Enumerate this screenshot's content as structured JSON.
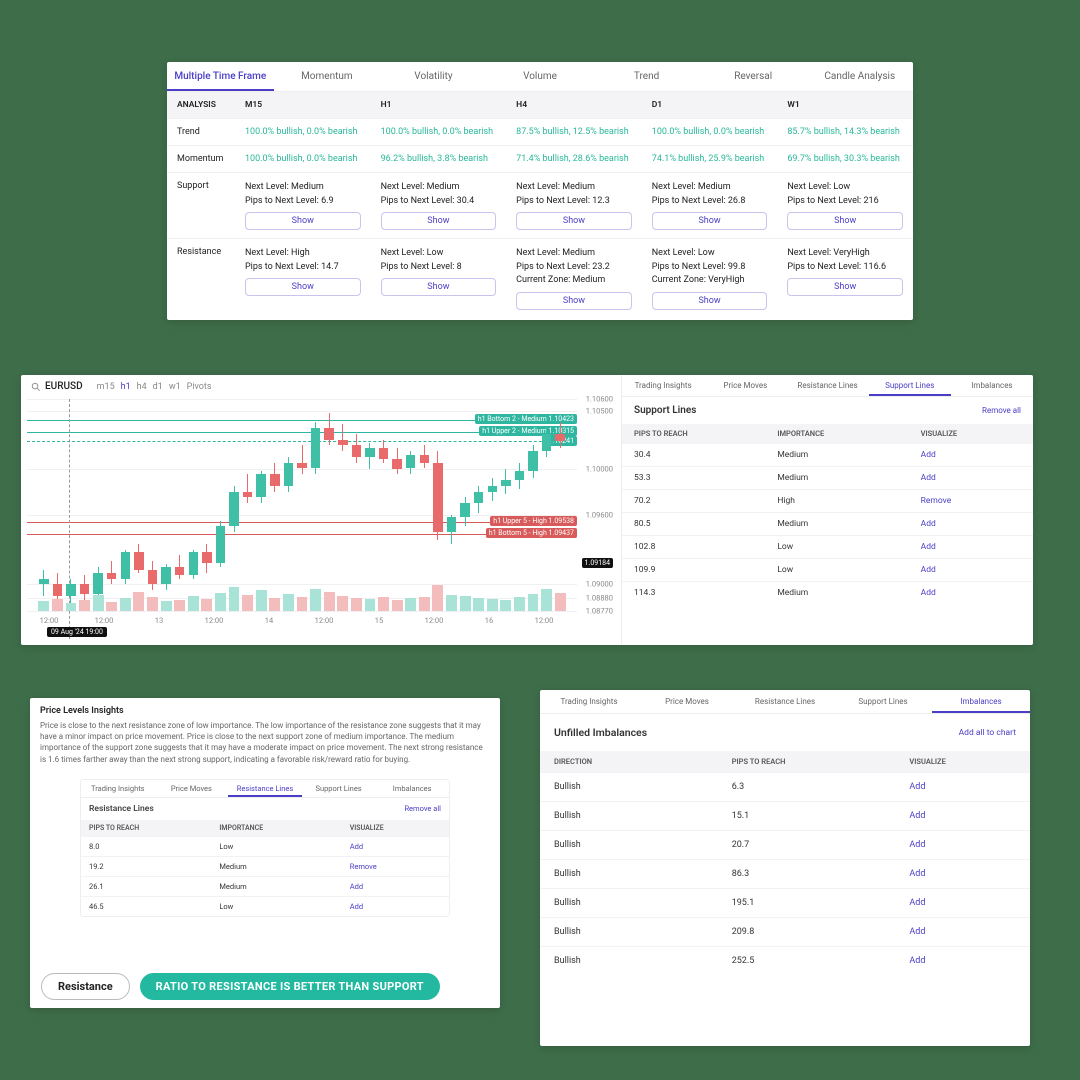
{
  "p1": {
    "tabs": [
      "Multiple Time Frame",
      "Momentum",
      "Volatility",
      "Volume",
      "Trend",
      "Reversal",
      "Candle Analysis"
    ],
    "active": 0,
    "cols": [
      "ANALYSIS",
      "M15",
      "H1",
      "H4",
      "D1",
      "W1"
    ],
    "rows": [
      {
        "label": "Trend",
        "cells": [
          {
            "text": "100.0% bullish, 0.0% bearish"
          },
          {
            "text": "100.0% bullish, 0.0% bearish"
          },
          {
            "text": "87.5% bullish, 12.5% bearish"
          },
          {
            "text": "100.0% bullish, 0.0% bearish"
          },
          {
            "text": "85.7% bullish, 14.3% bearish"
          }
        ]
      },
      {
        "label": "Momentum",
        "cells": [
          {
            "text": "100.0% bullish, 0.0% bearish"
          },
          {
            "text": "96.2% bullish, 3.8% bearish"
          },
          {
            "text": "71.4% bullish, 28.6% bearish"
          },
          {
            "text": "74.1% bullish, 25.9% bearish"
          },
          {
            "text": "69.7% bullish, 30.3% bearish"
          }
        ]
      },
      {
        "label": "Support",
        "cells": [
          {
            "next": "Next Level: Medium",
            "pips": "Pips to Next Level: 6.9",
            "show": "Show"
          },
          {
            "next": "Next Level: Medium",
            "pips": "Pips to Next Level: 30.4",
            "show": "Show"
          },
          {
            "next": "Next Level: Medium",
            "pips": "Pips to Next Level: 12.3",
            "show": "Show"
          },
          {
            "next": "Next Level: Medium",
            "pips": "Pips to Next Level: 26.8",
            "show": "Show"
          },
          {
            "next": "Next Level: Low",
            "pips": "Pips to Next Level: 216",
            "show": "Show"
          }
        ]
      },
      {
        "label": "Resistance",
        "cells": [
          {
            "next": "Next Level: High",
            "pips": "Pips to Next Level: 14.7",
            "show": "Show"
          },
          {
            "next": "Next Level: Low",
            "pips": "Pips to Next Level: 8",
            "show": "Show"
          },
          {
            "next": "Next Level: Medium",
            "pips": "Pips to Next Level: 23.2",
            "zone": "Current Zone: Medium",
            "show": "Show"
          },
          {
            "next": "Next Level: Low",
            "pips": "Pips to Next Level: 99.8",
            "zone": "Current Zone: VeryHigh",
            "show": "Show"
          },
          {
            "next": "Next Level: VeryHigh",
            "pips": "Pips to Next Level: 116.6",
            "show": "Show"
          }
        ]
      }
    ]
  },
  "p2": {
    "symbol": "EURUSD",
    "tfs": [
      "m15",
      "h1",
      "h4",
      "d1",
      "w1",
      "Pivots"
    ],
    "tf_active": 1,
    "side_tabs": [
      "Trading Insights",
      "Price Moves",
      "Resistance Lines",
      "Support Lines",
      "Imbalances"
    ],
    "side_active": 3,
    "side_title": "Support Lines",
    "remove_all": "Remove all",
    "headers": [
      "PIPS TO REACH",
      "IMPORTANCE",
      "VISUALIZE"
    ],
    "rows": [
      {
        "pips": "30.4",
        "imp": "Medium",
        "act": "Add"
      },
      {
        "pips": "53.3",
        "imp": "Medium",
        "act": "Add"
      },
      {
        "pips": "70.2",
        "imp": "High",
        "act": "Remove"
      },
      {
        "pips": "80.5",
        "imp": "Medium",
        "act": "Add"
      },
      {
        "pips": "102.8",
        "imp": "Low",
        "act": "Add"
      },
      {
        "pips": "109.9",
        "imp": "Low",
        "act": "Add"
      },
      {
        "pips": "114.3",
        "imp": "Medium",
        "act": "Add"
      }
    ],
    "ylabels": [
      "1.10600",
      "1.10500",
      "1.10000",
      "1.09600",
      "1.09000",
      "1.08880",
      "1.08770"
    ],
    "xlabels": [
      "12:00",
      "12:00",
      "13",
      "12:00",
      "14",
      "12:00",
      "15",
      "12:00",
      "16",
      "12:00"
    ],
    "price_last": "1.10241",
    "markers": {
      "up2": {
        "label": "h1 Upper 2 - Medium",
        "val": "1.10315",
        "color": "#2fb6a0"
      },
      "bt2": {
        "label": "h1 Bottom 2 - Medium",
        "val": "1.10423",
        "color": "#2fb6a0"
      },
      "up5": {
        "label": "h1 Upper 5 - High",
        "val": "1.09538",
        "color": "#d85a5a"
      },
      "bt5": {
        "label": "h1 Bottom 5 - High",
        "val": "1.09437",
        "color": "#d85a5a"
      }
    },
    "date_drag": "09 Aug '24  19:00",
    "current_price_badge": "1.09184"
  },
  "p3": {
    "title": "Price Levels Insights",
    "body": "Price is close to the next resistance zone of low importance. The low importance of the resistance zone suggests that it may have a minor impact on price movement. Price is close to the next support zone of medium importance. The medium importance of the support zone suggests that it may have a moderate impact on price movement. The next strong resistance is 1.6 times farther away than the next strong support, indicating a favorable risk/reward ratio for buying.",
    "res_tabs": [
      "Trading Insights",
      "Price Moves",
      "Resistance Lines",
      "Support Lines",
      "Imbalances"
    ],
    "res_active": 2,
    "res_title": "Resistance Lines",
    "remove_all": "Remove all",
    "headers": [
      "PIPS TO REACH",
      "IMPORTANCE",
      "VISUALIZE"
    ],
    "rows": [
      {
        "pips": "8.0",
        "imp": "Low",
        "act": "Add"
      },
      {
        "pips": "19.2",
        "imp": "Medium",
        "act": "Remove"
      },
      {
        "pips": "26.1",
        "imp": "Medium",
        "act": "Add"
      },
      {
        "pips": "46.5",
        "imp": "Low",
        "act": "Add"
      }
    ],
    "pill_res": "Resistance",
    "pill_ratio": "RATIO TO RESISTANCE IS BETTER THAN SUPPORT"
  },
  "p4": {
    "tabs": [
      "Trading Insights",
      "Price Moves",
      "Resistance Lines",
      "Support Lines",
      "Imbalances"
    ],
    "active": 4,
    "title": "Unfilled Imbalances",
    "add_all": "Add all to chart",
    "headers": [
      "DIRECTION",
      "PIPS TO REACH",
      "VISUALIZE"
    ],
    "rows": [
      {
        "dir": "Bullish",
        "pips": "6.3",
        "act": "Add"
      },
      {
        "dir": "Bullish",
        "pips": "15.1",
        "act": "Add"
      },
      {
        "dir": "Bullish",
        "pips": "20.7",
        "act": "Add"
      },
      {
        "dir": "Bullish",
        "pips": "86.3",
        "act": "Add"
      },
      {
        "dir": "Bullish",
        "pips": "195.1",
        "act": "Add"
      },
      {
        "dir": "Bullish",
        "pips": "209.8",
        "act": "Add"
      },
      {
        "dir": "Bullish",
        "pips": "252.5",
        "act": "Add"
      }
    ]
  },
  "chart_data": {
    "type": "candlestick+volume",
    "symbol": "EURUSD",
    "timeframe": "h1",
    "ylim": [
      1.0877,
      1.106
    ],
    "y_ticks": [
      1.106,
      1.105,
      1.1,
      1.096,
      1.09,
      1.0888,
      1.0877
    ],
    "x_ticks_labels": [
      "12:00",
      "",
      "13",
      "",
      "14",
      "",
      "15",
      "",
      "16",
      ""
    ],
    "last_price": 1.10241,
    "badge_price": 1.09184,
    "support_lines": [
      {
        "name": "h1 Upper 2",
        "level": 1.10315,
        "importance": "Medium"
      },
      {
        "name": "h1 Bottom 2",
        "level": 1.10423,
        "importance": "Medium"
      }
    ],
    "resistance_lines": [
      {
        "name": "h1 Upper 5",
        "level": 1.09538,
        "importance": "High"
      },
      {
        "name": "h1 Bottom 5",
        "level": 1.09437,
        "importance": "High"
      }
    ],
    "candles": [
      {
        "o": 1.0905,
        "h": 1.0912,
        "l": 1.089,
        "c": 1.09,
        "dir": "bull"
      },
      {
        "o": 1.09,
        "h": 1.091,
        "l": 1.0885,
        "c": 1.089,
        "dir": "bear"
      },
      {
        "o": 1.089,
        "h": 1.0905,
        "l": 1.088,
        "c": 1.09,
        "dir": "bull"
      },
      {
        "o": 1.09,
        "h": 1.0908,
        "l": 1.0885,
        "c": 1.0892,
        "dir": "bear"
      },
      {
        "o": 1.0892,
        "h": 1.0915,
        "l": 1.089,
        "c": 1.091,
        "dir": "bull"
      },
      {
        "o": 1.091,
        "h": 1.092,
        "l": 1.09,
        "c": 1.0905,
        "dir": "bear"
      },
      {
        "o": 1.0905,
        "h": 1.093,
        "l": 1.09,
        "c": 1.0928,
        "dir": "bull"
      },
      {
        "o": 1.0928,
        "h": 1.0935,
        "l": 1.091,
        "c": 1.0912,
        "dir": "bear"
      },
      {
        "o": 1.0912,
        "h": 1.092,
        "l": 1.0895,
        "c": 1.09,
        "dir": "bear"
      },
      {
        "o": 1.09,
        "h": 1.0918,
        "l": 1.0895,
        "c": 1.0915,
        "dir": "bull"
      },
      {
        "o": 1.0915,
        "h": 1.0925,
        "l": 1.0905,
        "c": 1.0908,
        "dir": "bear"
      },
      {
        "o": 1.0908,
        "h": 1.093,
        "l": 1.0905,
        "c": 1.0928,
        "dir": "bull"
      },
      {
        "o": 1.0928,
        "h": 1.0935,
        "l": 1.091,
        "c": 1.0918,
        "dir": "bear"
      },
      {
        "o": 1.0918,
        "h": 1.0955,
        "l": 1.0915,
        "c": 1.095,
        "dir": "bull"
      },
      {
        "o": 1.095,
        "h": 1.0985,
        "l": 1.0945,
        "c": 1.098,
        "dir": "bull"
      },
      {
        "o": 1.098,
        "h": 1.0995,
        "l": 1.097,
        "c": 1.0975,
        "dir": "bear"
      },
      {
        "o": 1.0975,
        "h": 1.0998,
        "l": 1.097,
        "c": 1.0995,
        "dir": "bull"
      },
      {
        "o": 1.0995,
        "h": 1.1005,
        "l": 1.098,
        "c": 1.0985,
        "dir": "bear"
      },
      {
        "o": 1.0985,
        "h": 1.101,
        "l": 1.098,
        "c": 1.1005,
        "dir": "bull"
      },
      {
        "o": 1.1005,
        "h": 1.102,
        "l": 1.0995,
        "c": 1.1,
        "dir": "bear"
      },
      {
        "o": 1.1,
        "h": 1.104,
        "l": 1.0995,
        "c": 1.1035,
        "dir": "bull"
      },
      {
        "o": 1.1035,
        "h": 1.1048,
        "l": 1.102,
        "c": 1.1025,
        "dir": "bear"
      },
      {
        "o": 1.1025,
        "h": 1.1038,
        "l": 1.1015,
        "c": 1.102,
        "dir": "bear"
      },
      {
        "o": 1.102,
        "h": 1.103,
        "l": 1.1005,
        "c": 1.101,
        "dir": "bear"
      },
      {
        "o": 1.101,
        "h": 1.1022,
        "l": 1.1,
        "c": 1.1018,
        "dir": "bull"
      },
      {
        "o": 1.1018,
        "h": 1.1025,
        "l": 1.1005,
        "c": 1.1008,
        "dir": "bear"
      },
      {
        "o": 1.1008,
        "h": 1.1018,
        "l": 1.0995,
        "c": 1.1,
        "dir": "bear"
      },
      {
        "o": 1.1,
        "h": 1.1015,
        "l": 1.0995,
        "c": 1.1012,
        "dir": "bull"
      },
      {
        "o": 1.1012,
        "h": 1.102,
        "l": 1.1,
        "c": 1.1005,
        "dir": "bear"
      },
      {
        "o": 1.1005,
        "h": 1.1015,
        "l": 1.0938,
        "c": 1.0945,
        "dir": "bear"
      },
      {
        "o": 1.0945,
        "h": 1.096,
        "l": 1.0935,
        "c": 1.0958,
        "dir": "bull"
      },
      {
        "o": 1.0958,
        "h": 1.0975,
        "l": 1.095,
        "c": 1.097,
        "dir": "bull"
      },
      {
        "o": 1.097,
        "h": 1.0985,
        "l": 1.0962,
        "c": 1.098,
        "dir": "bull"
      },
      {
        "o": 1.098,
        "h": 1.0992,
        "l": 1.0972,
        "c": 1.0985,
        "dir": "bull"
      },
      {
        "o": 1.0985,
        "h": 1.1,
        "l": 1.0978,
        "c": 1.099,
        "dir": "bull"
      },
      {
        "o": 1.099,
        "h": 1.1005,
        "l": 1.0982,
        "c": 1.0998,
        "dir": "bull"
      },
      {
        "o": 1.0998,
        "h": 1.102,
        "l": 1.0992,
        "c": 1.1015,
        "dir": "bull"
      },
      {
        "o": 1.1015,
        "h": 1.1035,
        "l": 1.101,
        "c": 1.103,
        "dir": "bull"
      },
      {
        "o": 1.103,
        "h": 1.104,
        "l": 1.1018,
        "c": 1.1024,
        "dir": "bear"
      }
    ],
    "volume": [
      18,
      22,
      14,
      20,
      30,
      16,
      24,
      36,
      26,
      18,
      20,
      28,
      22,
      34,
      44,
      30,
      38,
      24,
      32,
      26,
      40,
      36,
      28,
      24,
      22,
      26,
      20,
      24,
      26,
      48,
      30,
      28,
      24,
      22,
      20,
      26,
      32,
      40,
      34
    ]
  }
}
